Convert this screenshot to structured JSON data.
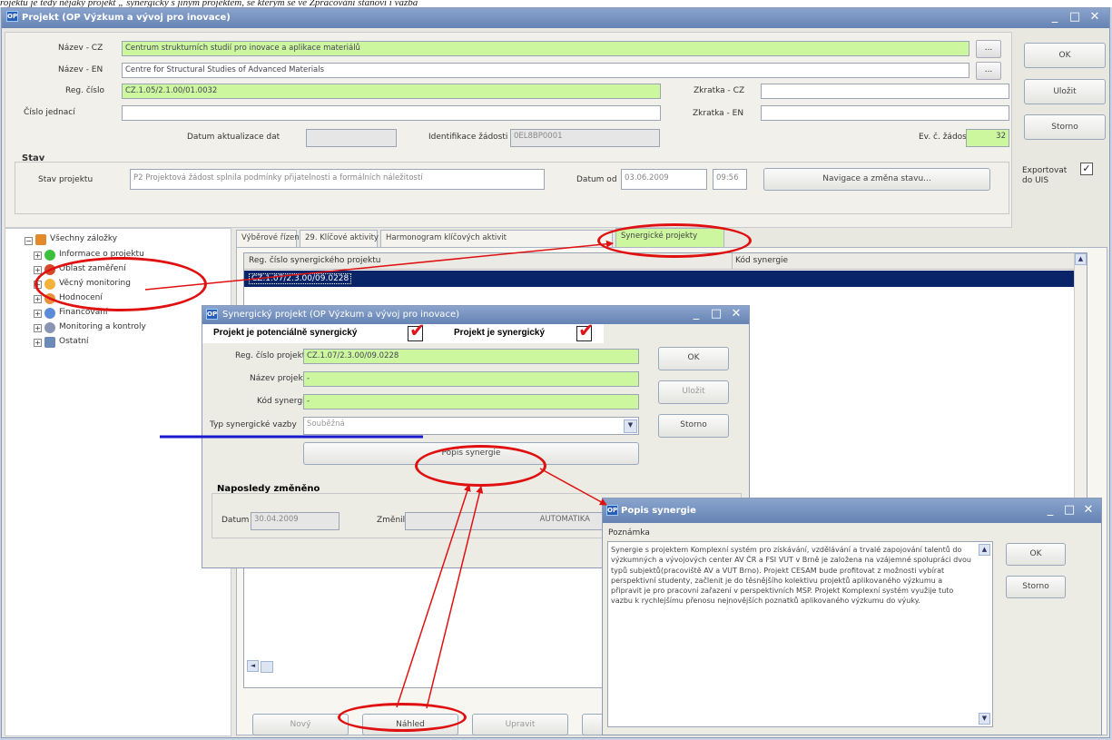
{
  "caption": "rojektu je tedy nějaký projekt „ synergický s jiným projektem, se kterým se ve Zpracování stanoví i vazba",
  "main_window": {
    "title": "Projekt  (OP Výzkum a vývoj pro inovace)",
    "nazev_cz_label": "Název - CZ",
    "nazev_cz": "Centrum strukturních studií pro inovace a aplikace materiálů",
    "nazev_en_label": "Název - EN",
    "nazev_en": "Centre for Structural Studies of Advanced Materials",
    "reg_cislo_label": "Reg. číslo",
    "reg_cislo": "CZ.1.05/2.1.00/01.0032",
    "cislo_jednaci_label": "Číslo jednací",
    "cislo_jednaci": "",
    "zkratka_cz_label": "Zkratka - CZ",
    "zkratka_cz": "",
    "zkratka_en_label": "Zkratka - EN",
    "zkratka_en": "",
    "datum_akt_label": "Datum aktualizace dat",
    "datum_akt": "",
    "identifikace_label": "Identifikace žádosti",
    "identifikace": "0EL8BP0001",
    "ev_zadosti_label": "Ev. č. žádosti",
    "ev_zadosti": "32",
    "stav_heading": "Stav",
    "stav_projektu_label": "Stav projektu",
    "stav_projektu": "P2 Projektová žádost splnila podmínky přijatelnosti a formálních náležitostí",
    "datum_od_label": "Datum od",
    "datum_od": "03.06.2009",
    "cas_od": "09:56",
    "navigace_button": "Navigace a změna stavu...",
    "ok_button": "OK",
    "ulozit_button": "Uložit",
    "storno_button": "Storno",
    "exportovat_label_1": "Exportovat",
    "exportovat_label_2": "do UIS",
    "exportovat_check": "✓",
    "dots": "...",
    "tree": {
      "root": "Všechny záložky",
      "items": [
        "Informace o projektu",
        "Oblast zaměření",
        "Věcný monitoring",
        "Hodnocení",
        "Financování",
        "Monitoring a kontroly",
        "Ostatní"
      ]
    },
    "tabs": [
      "Výběrové řízení",
      "29. Klíčové aktivity",
      "Harmonogram klíčových aktivit",
      "Synergické projekty"
    ],
    "grid_col1": "Reg. číslo synergického projektu",
    "grid_col2": "Kód synergie",
    "grid_row1": "CZ.1.07/2.3.00/09.0228",
    "bottom_buttons": [
      "Nový",
      "Náhled",
      "Upravit"
    ]
  },
  "synergy_window": {
    "title": "Synergický projekt  (OP Výzkum a vývoj pro inovace)",
    "check1_label": "Projekt je potenciálně synergický",
    "check2_label": "Projekt je synergický",
    "check_mark": "✔",
    "reg_label": "Reg. číslo projektu",
    "reg_value": "CZ.1.07/2.3.00/09.0228",
    "nazev_label": "Název projektu",
    "nazev_value": "-",
    "kod_label": "Kód synergie",
    "kod_value": "-",
    "typ_label": "Typ synergické vazby",
    "typ_value": "Souběžná",
    "popis_button": "Popis synergie",
    "ok_button": "OK",
    "ulozit_button": "Uložit",
    "storno_button": "Storno",
    "naposledy_heading": "Naposledy změněno",
    "datum_label": "Datum",
    "datum_value": "30.04.2009",
    "zmenil_label": "Změnil",
    "zmenil_value": "AUTOMATIKA"
  },
  "popis_window": {
    "title": "Popis synergie",
    "poznamka_label": "Poznámka",
    "text": "Synergie s projektem Komplexní systém pro získávání, vzdělávání a trvalé zapojování talentů do výzkumných a vývojových center AV ČR a FSI VUT v Brně je založena na vzájemné spolupráci dvou typů subjektů(pracoviště AV a VUT Brno). Projekt CESAM bude profitovat z možnosti vybírat perspektivní studenty, začlenit je do těsnějšího kolektivu projektů aplikovaného výzkumu a připravit je pro pracovní zařazení v perspektivních MSP. Projekt Komplexní systém využije tuto vazbu k rychlejšímu přenosu nejnovějších poznatků aplikovaného výzkumu do výuky.",
    "ok_button": "OK",
    "storno_button": "Storno"
  },
  "window_controls": {
    "minimize": "_",
    "maximize": "□",
    "close": "✕"
  }
}
